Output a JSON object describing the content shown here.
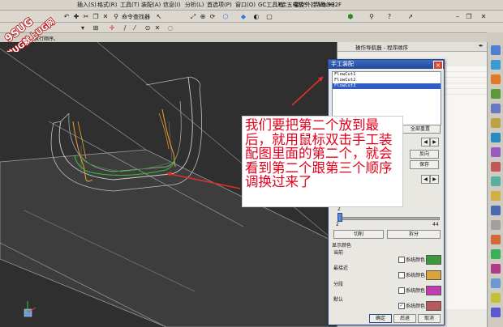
{
  "menubar": {
    "items": [
      "插入(S)",
      "格式(R)",
      "工具(T)",
      "装配(A)",
      "信息(I)",
      "分析(L)",
      "首选项(P)",
      "窗口(O)",
      "GC工具箱",
      "帮助(H)"
    ],
    "title_segment": "*走五电极*",
    "version": "星空外挂 V6.932F"
  },
  "toolbar": {
    "command_finder": "命令查找器"
  },
  "hint": {
    "text": "执行顺序。"
  },
  "navigator": {
    "title": "操作导航器 - 程序顺序"
  },
  "dialog": {
    "title": "手工装配",
    "close": "×",
    "list_items": [
      "FlowCut1",
      "FlowCut2",
      "FlowCut3"
    ],
    "buttons": {
      "reorder": "全部重置",
      "reverse": "反向",
      "save": "保存",
      "cut": "切削",
      "split": "拆分",
      "ok": "确定",
      "back": "后退",
      "cancel": "取消"
    },
    "slider": {
      "min": "2",
      "max": "44",
      "top_value": "2"
    },
    "display_colors": {
      "heading": "显示颜色",
      "rows": [
        {
          "label": "当前",
          "check_label": "系统颜色",
          "checked": false,
          "color": "#3a9a3a"
        },
        {
          "label": "最接近",
          "check_label": "系统颜色",
          "checked": false,
          "color": "#d9a53a"
        },
        {
          "label": "分段",
          "check_label": "系统颜色",
          "checked": false,
          "color": "#c23bb0"
        },
        {
          "label": "默认",
          "check_label": "系统颜色",
          "checked": true,
          "color": "#b85a5a"
        }
      ]
    }
  },
  "annotation": {
    "text": "我们要把第二个放到最后，就用鼠标双击手工装配图里面的第二个，就会看到第二个跟第三个顺序调换过来了"
  },
  "watermark": {
    "line1": "9SUG",
    "line2": "学UG就上UG网"
  },
  "colors": {
    "arrow": "#e0302a",
    "toolpath_orange": "#f0a030",
    "toolpath_green": "#3ac03a",
    "title_bar": "#2f5cc6"
  }
}
